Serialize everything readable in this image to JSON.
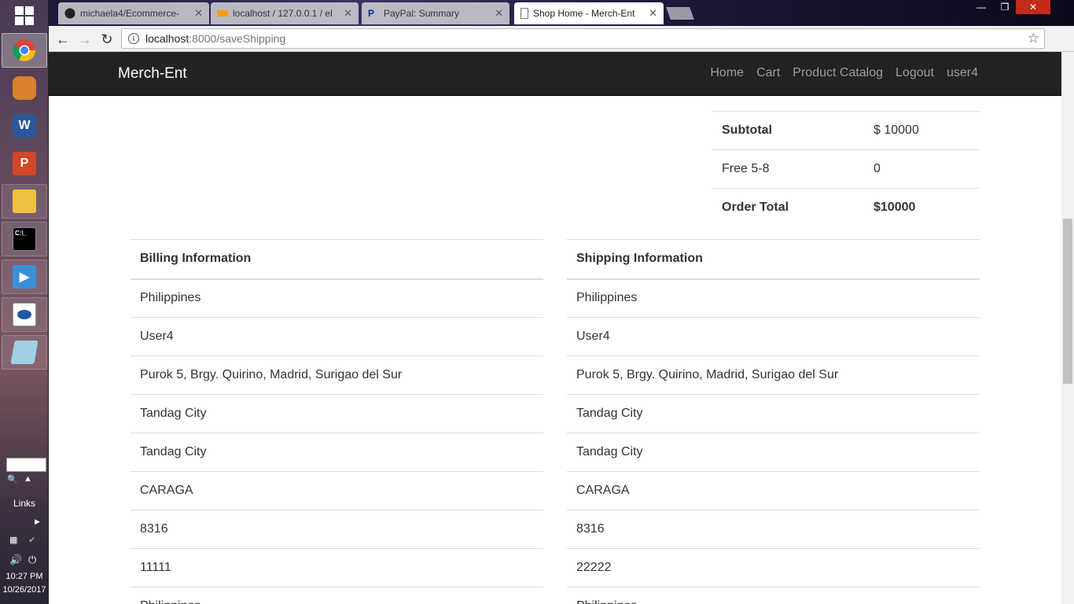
{
  "taskbar": {
    "links_label": "Links",
    "clock_time": "10:27 PM",
    "clock_date": "10/26/2017"
  },
  "browser": {
    "tabs": [
      {
        "title": "michaela4/Ecommerce-"
      },
      {
        "title": "localhost / 127.0.0.1 / el"
      },
      {
        "title": "PayPal: Summary"
      },
      {
        "title": "Shop Home - Merch-Ent"
      }
    ],
    "url_host": "localhost",
    "url_path": ":8000/saveShipping"
  },
  "navbar": {
    "brand": "Merch-Ent",
    "links": [
      "Home",
      "Cart",
      "Product Catalog",
      "Logout",
      "user4"
    ]
  },
  "totals": {
    "subtotal_label": "Subtotal",
    "subtotal_value": "$ 10000",
    "shipping_label": "Free 5-8",
    "shipping_value": "0",
    "order_total_label": "Order Total",
    "order_total_value": "$10000"
  },
  "billing": {
    "heading": "Billing Information",
    "rows": [
      "Philippines",
      "User4",
      "Purok 5, Brgy. Quirino, Madrid, Surigao del Sur",
      "Tandag City",
      "Tandag City",
      "CARAGA",
      "8316",
      "11111",
      "Philippines"
    ]
  },
  "shipping": {
    "heading": "Shipping Information",
    "rows": [
      "Philippines",
      "User4",
      "Purok 5, Brgy. Quirino, Madrid, Surigao del Sur",
      "Tandag City",
      "Tandag City",
      "CARAGA",
      "8316",
      "22222",
      "Philippines"
    ]
  }
}
